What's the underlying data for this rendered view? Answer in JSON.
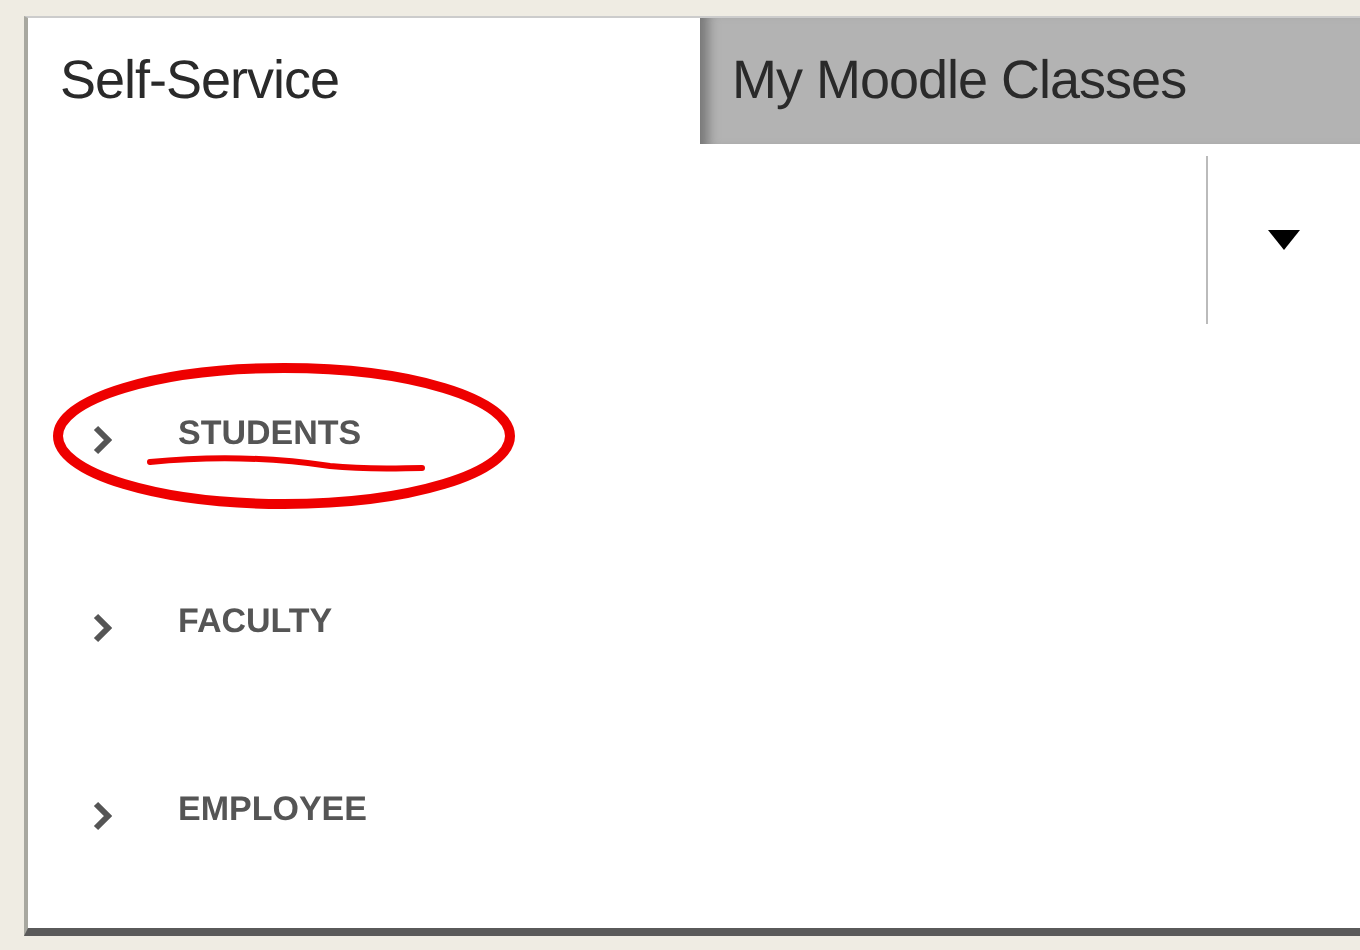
{
  "tabs": [
    {
      "label": "Self-Service",
      "selected": true
    },
    {
      "label": "My Moodle Classes",
      "selected": false
    }
  ],
  "dropdown": {
    "expanded": false
  },
  "menu_items": [
    {
      "label": "STUDENTS",
      "circled": true
    },
    {
      "label": "FACULTY",
      "circled": false
    },
    {
      "label": "EMPLOYEE",
      "circled": false
    }
  ]
}
